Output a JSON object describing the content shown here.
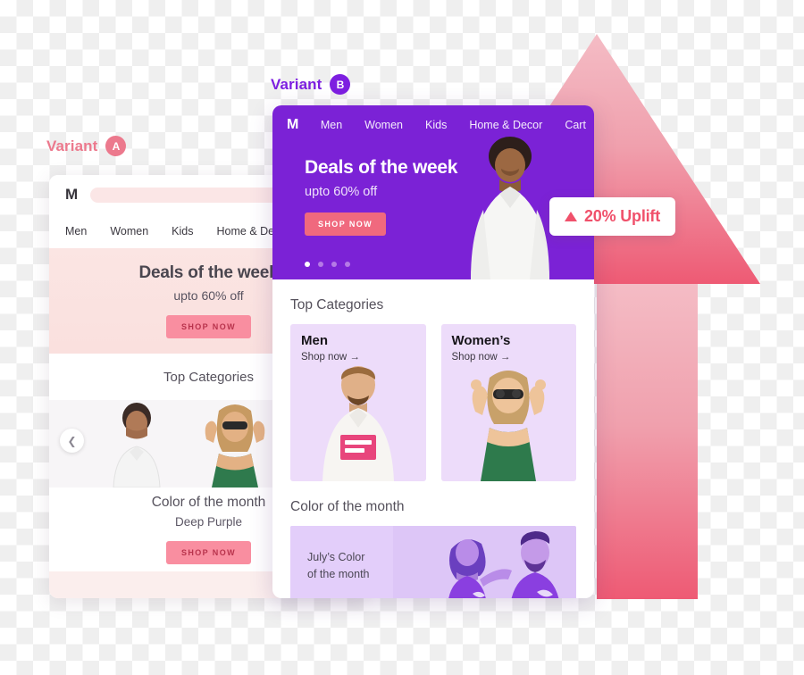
{
  "variant_a": {
    "label": "Variant",
    "badge": "A",
    "accent_color": "#ec798d",
    "logo": "M",
    "nav": [
      "Men",
      "Women",
      "Kids",
      "Home & Deco"
    ],
    "hero": {
      "title": "Deals of the week",
      "subtitle": "upto 60% off",
      "cta": "SHOP NOW"
    },
    "top_categories_title": "Top Categories",
    "carousel_prev_icon": "chevron-left",
    "color_of_the_month": {
      "title": "Color of the month",
      "subtitle": "Deep Purple",
      "cta": "SHOP NOW"
    }
  },
  "variant_b": {
    "label": "Variant",
    "badge": "B",
    "accent_color": "#7d1fe0",
    "logo": "M",
    "nav": [
      "Men",
      "Women",
      "Kids",
      "Home & Decor",
      "Cart"
    ],
    "hero": {
      "title": "Deals of the week",
      "subtitle": "upto 60% off",
      "cta": "SHOP NOW",
      "dots": 4,
      "active_dot": 0
    },
    "top_categories_title": "Top Categories",
    "categories": [
      {
        "title": "Men",
        "link": "Shop now →"
      },
      {
        "title": "Women’s",
        "link": "Shop now →"
      }
    ],
    "color_of_the_month": {
      "title": "Color of the month",
      "banner_line1": "July’s Color",
      "banner_line2": "of the month"
    }
  },
  "uplift_badge": {
    "icon": "triangle-up",
    "text": "20% Uplift",
    "color": "#f0516b"
  },
  "background": {
    "arrow_color_top": "#f2b3bd",
    "arrow_color_bottom": "#ef5f77"
  }
}
